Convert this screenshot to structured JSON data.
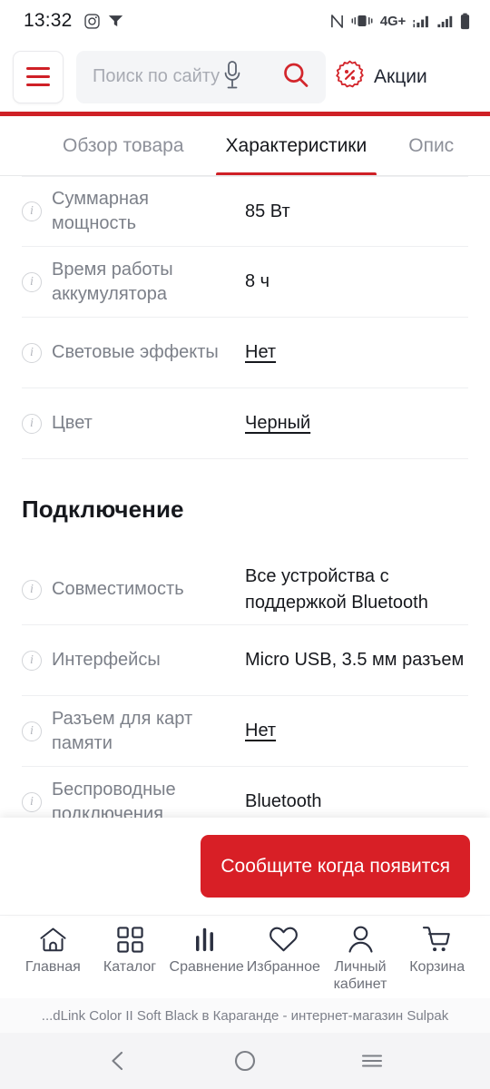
{
  "status_bar": {
    "clock": "13:32",
    "left_icons": [
      "camera-icon",
      "screencast-icon"
    ],
    "network_label": "4G+",
    "right_icons": [
      "nfc-icon",
      "vibrate-icon",
      "signal-bars-icon",
      "signal-bars-secondary-icon",
      "battery-icon"
    ]
  },
  "header": {
    "menu_icon": "hamburger-icon",
    "search_placeholder": "Поиск по сайту",
    "mic_icon": "microphone-icon",
    "search_icon": "search-icon",
    "promo_icon": "discount-badge-icon",
    "promo_label": "Акции"
  },
  "tabs": [
    {
      "label": "Обзор товара",
      "active": false
    },
    {
      "label": "Характеристики",
      "active": true
    },
    {
      "label": "Опис",
      "active": false
    }
  ],
  "specs": [
    {
      "label": "Суммарная мощность",
      "value": "85 Вт",
      "linked": false
    },
    {
      "label": "Время работы аккумулятора",
      "value": "8 ч",
      "linked": false
    },
    {
      "label": "Световые эффекты",
      "value": "Нет",
      "linked": true
    },
    {
      "label": "Цвет",
      "value": "Черный",
      "linked": true
    }
  ],
  "section": {
    "title": "Подключение",
    "specs": [
      {
        "label": "Совместимость",
        "value": "Все устройства с поддержкой Bluetooth",
        "linked": false
      },
      {
        "label": "Интерфейсы",
        "value": "Micro USB, 3.5 мм разъем",
        "linked": false
      },
      {
        "label": "Разъем для карт памяти",
        "value": "Нет",
        "linked": true
      },
      {
        "label": "Беспроводные подключения",
        "value": "Bluetooth",
        "linked": false
      }
    ]
  },
  "cta": {
    "label": "Сообщите когда появится",
    "color": "#d81f26"
  },
  "bottom_nav": [
    {
      "label": "Главная",
      "icon": "home-icon"
    },
    {
      "label": "Каталог",
      "icon": "grid-icon"
    },
    {
      "label": "Сравнение",
      "icon": "bar-chart-icon"
    },
    {
      "label": "Избранное",
      "icon": "heart-icon"
    },
    {
      "label": "Личный кабинет",
      "icon": "user-icon"
    },
    {
      "label": "Корзина",
      "icon": "cart-icon"
    }
  ],
  "page_caption": "...dLink Color II Soft Black в Караганде - интернет-магазин Sulpak",
  "android_nav": [
    {
      "icon": "back-icon"
    },
    {
      "icon": "home-circle-icon"
    },
    {
      "icon": "recents-icon"
    }
  ],
  "theme": {
    "brand_red": "#cf2026",
    "cta_red": "#d81f26",
    "label_gray": "#7c8089",
    "value_black": "#16181d"
  }
}
